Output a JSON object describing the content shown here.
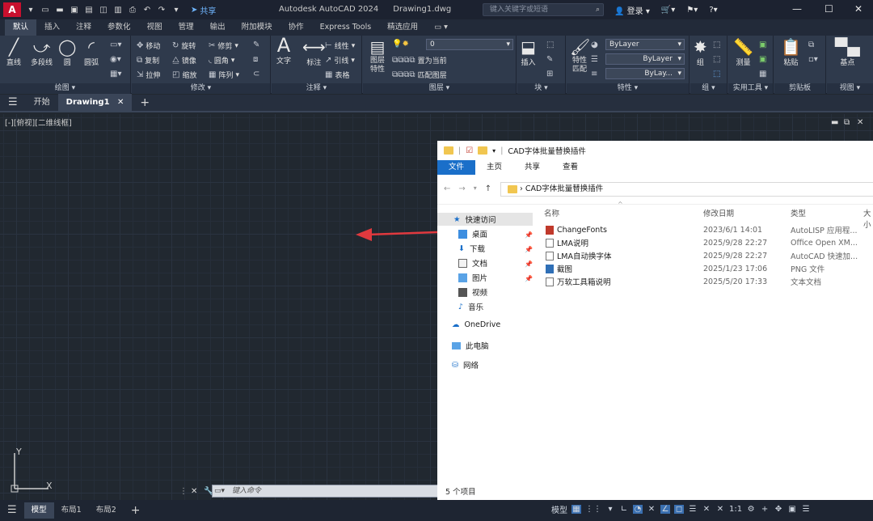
{
  "app": {
    "title": "Autodesk AutoCAD 2024",
    "filename": "Drawing1.dwg",
    "share": "共享",
    "search_placeholder": "键入关键字或短语",
    "login": "登录"
  },
  "ribbon_tabs": [
    "默认",
    "插入",
    "注释",
    "参数化",
    "视图",
    "管理",
    "输出",
    "附加模块",
    "协作",
    "Express Tools",
    "精选应用"
  ],
  "panels": {
    "draw": {
      "title": "绘图",
      "items": [
        "直线",
        "多段线",
        "圆",
        "圆弧"
      ]
    },
    "modify": {
      "title": "修改",
      "items": [
        "移动",
        "旋转",
        "修剪",
        "复制",
        "镜像",
        "圆角",
        "拉伸",
        "缩放",
        "阵列"
      ]
    },
    "annotation": {
      "title": "注释",
      "items": [
        "文字",
        "标注",
        "线性",
        "引线",
        "表格"
      ]
    },
    "layers": {
      "title": "图层",
      "items": [
        "图层特性",
        "置为当前",
        "匹配图层"
      ],
      "layer_value": "0"
    },
    "block": {
      "title": "块",
      "items": [
        "插入"
      ]
    },
    "properties": {
      "title": "特性",
      "items": [
        "特性匹配"
      ],
      "bylayer1": "ByLayer",
      "bylayer2": "ByLayer",
      "bylayer3": "ByLay..."
    },
    "groups": {
      "title": "组",
      "items": [
        "组"
      ]
    },
    "utilities": {
      "title": "实用工具",
      "items": [
        "测量"
      ]
    },
    "clipboard": {
      "title": "剪贴板",
      "items": [
        "粘贴"
      ]
    },
    "view": {
      "title": "视图",
      "items": [
        "基点"
      ]
    }
  },
  "doc_tabs": [
    "开始",
    "Drawing1"
  ],
  "viewport_label": "[-][俯视][二维线框]",
  "command_placeholder": "键入命令",
  "layout_tabs": [
    "模型",
    "布局1",
    "布局2"
  ],
  "status": {
    "model": "模型",
    "scale": "1:1"
  },
  "explorer": {
    "title": "CAD字体批量替换插件",
    "tabs": [
      "文件",
      "主页",
      "共享",
      "查看"
    ],
    "address": "CAD字体批量替换插件",
    "columns": [
      "名称",
      "修改日期",
      "类型",
      "大小"
    ],
    "nav": [
      "快速访问",
      "桌面",
      "下载",
      "文档",
      "图片",
      "视频",
      "音乐",
      "OneDrive",
      "此电脑",
      "网络"
    ],
    "files": [
      {
        "name": "ChangeFonts",
        "date": "2023/6/1 14:01",
        "type": "AutoLISP 应用程..."
      },
      {
        "name": "LMA说明",
        "date": "2025/9/28 22:27",
        "type": "Office Open XM..."
      },
      {
        "name": "LMA自动换字体",
        "date": "2025/9/28 22:27",
        "type": "AutoCAD 快速加..."
      },
      {
        "name": "截图",
        "date": "2025/1/23 17:06",
        "type": "PNG 文件"
      },
      {
        "name": "万软工具箱说明",
        "date": "2025/5/20 17:33",
        "type": "文本文档"
      }
    ],
    "count": "5 个项目"
  },
  "colors": {
    "accent": "#1a6fc9",
    "arrow": "#e0393e",
    "canvas": "#212830"
  }
}
